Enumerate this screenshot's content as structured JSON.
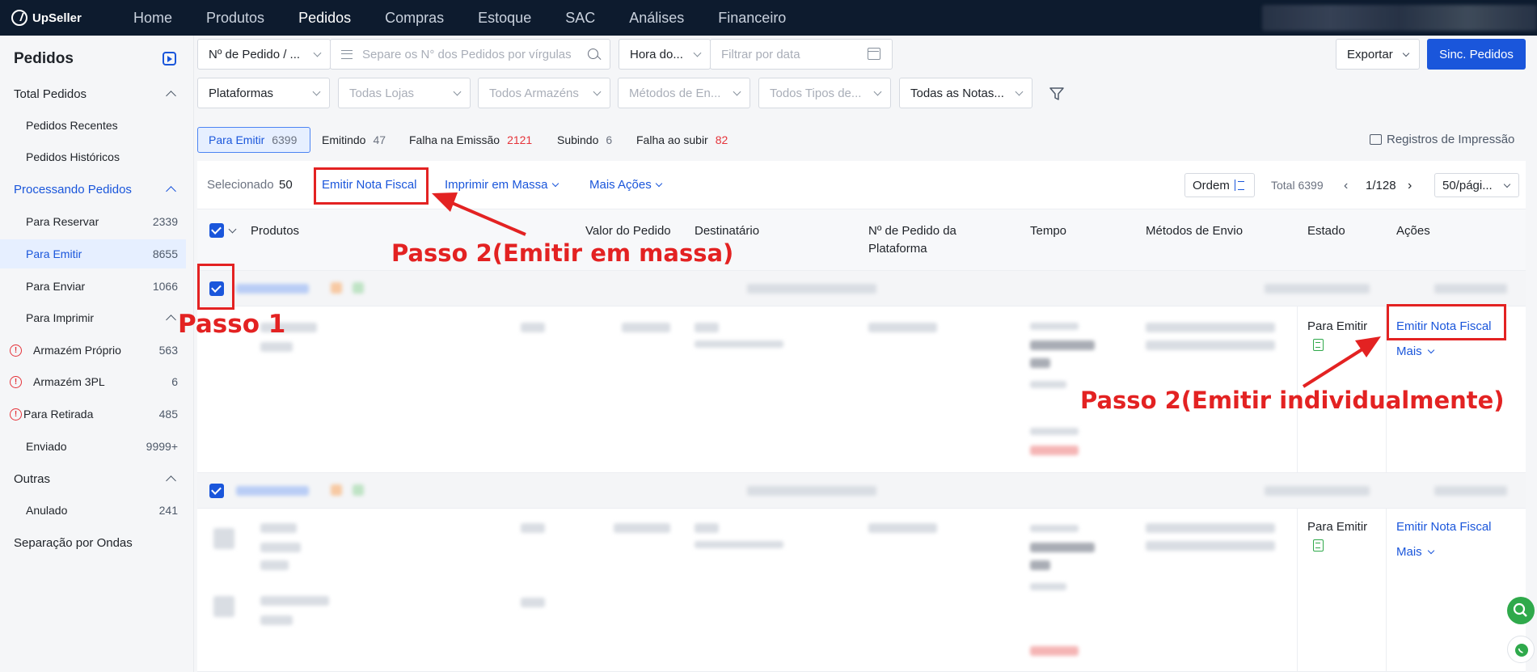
{
  "topbar": {
    "logo": "UpSeller",
    "nav": [
      "Home",
      "Produtos",
      "Pedidos",
      "Compras",
      "Estoque",
      "SAC",
      "Análises",
      "Financeiro"
    ],
    "active_nav": "Pedidos"
  },
  "sidebar": {
    "title": "Pedidos",
    "groups": {
      "total": "Total Pedidos",
      "recentes": "Pedidos Recentes",
      "historicos": "Pedidos Históricos",
      "processando": "Processando Pedidos",
      "outras": "Outras",
      "ondas": "Separação por Ondas"
    },
    "items": [
      {
        "label": "Para Reservar",
        "count": "2339"
      },
      {
        "label": "Para Emitir",
        "count": "8655"
      },
      {
        "label": "Para Enviar",
        "count": "1066"
      },
      {
        "label": "Para Imprimir",
        "count": ""
      },
      {
        "label": "Armazém Próprio",
        "count": "563"
      },
      {
        "label": "Armazém 3PL",
        "count": "6"
      },
      {
        "label": "Para Retirada",
        "count": "485"
      },
      {
        "label": "Enviado",
        "count": "9999+"
      },
      {
        "label": "Anulado",
        "count": "241"
      }
    ]
  },
  "filters": {
    "order_field": "Nº de Pedido / ...",
    "order_placeholder": "Separe os N° dos Pedidos por vírgulas",
    "time_field": "Hora do...",
    "date_placeholder": "Filtrar por data",
    "plataformas": "Plataformas",
    "lojas": "Todas Lojas",
    "armazens": "Todos Armazéns",
    "metodos": "Métodos de En...",
    "tipos": "Todos Tipos de...",
    "notas": "Todas as Notas..."
  },
  "actions": {
    "export": "Exportar",
    "sync": "Sinc. Pedidos"
  },
  "status_tabs": [
    {
      "label": "Para Emitir",
      "count": "6399"
    },
    {
      "label": "Emitindo",
      "count": "47"
    },
    {
      "label": "Falha na Emissão",
      "count": "2121"
    },
    {
      "label": "Subindo",
      "count": "6"
    },
    {
      "label": "Falha ao subir",
      "count": "82"
    }
  ],
  "print_log": "Registros de Impressão",
  "toolbar": {
    "selected_label": "Selecionado",
    "selected_count": "50",
    "emit": "Emitir Nota Fiscal",
    "print_bulk": "Imprimir em Massa",
    "more_actions": "Mais Ações",
    "ordem": "Ordem",
    "total": "Total 6399",
    "page": "1/128",
    "per_page": "50/pági..."
  },
  "columns": [
    "Produtos",
    "Valor do Pedido",
    "Destinatário",
    "Nº de Pedido da Plataforma",
    "Tempo",
    "Métodos de Envio",
    "Estado",
    "Ações"
  ],
  "orders": [
    {
      "estado": "Para Emitir",
      "action": "Emitir Nota Fiscal",
      "more": "Mais"
    },
    {
      "estado": "Para Emitir",
      "action": "Emitir Nota Fiscal",
      "more": "Mais"
    }
  ],
  "annotations": {
    "passo1": "Passo 1",
    "passo2_massa": "Passo 2(Emitir em massa)",
    "passo2_indiv": "Passo 2(Emitir individualmente)",
    "color": "#e32222"
  },
  "colors": {
    "primary": "#1a56db",
    "topbar": "#0d1b2e",
    "danger": "#e5333a",
    "success": "#2fa94b"
  }
}
